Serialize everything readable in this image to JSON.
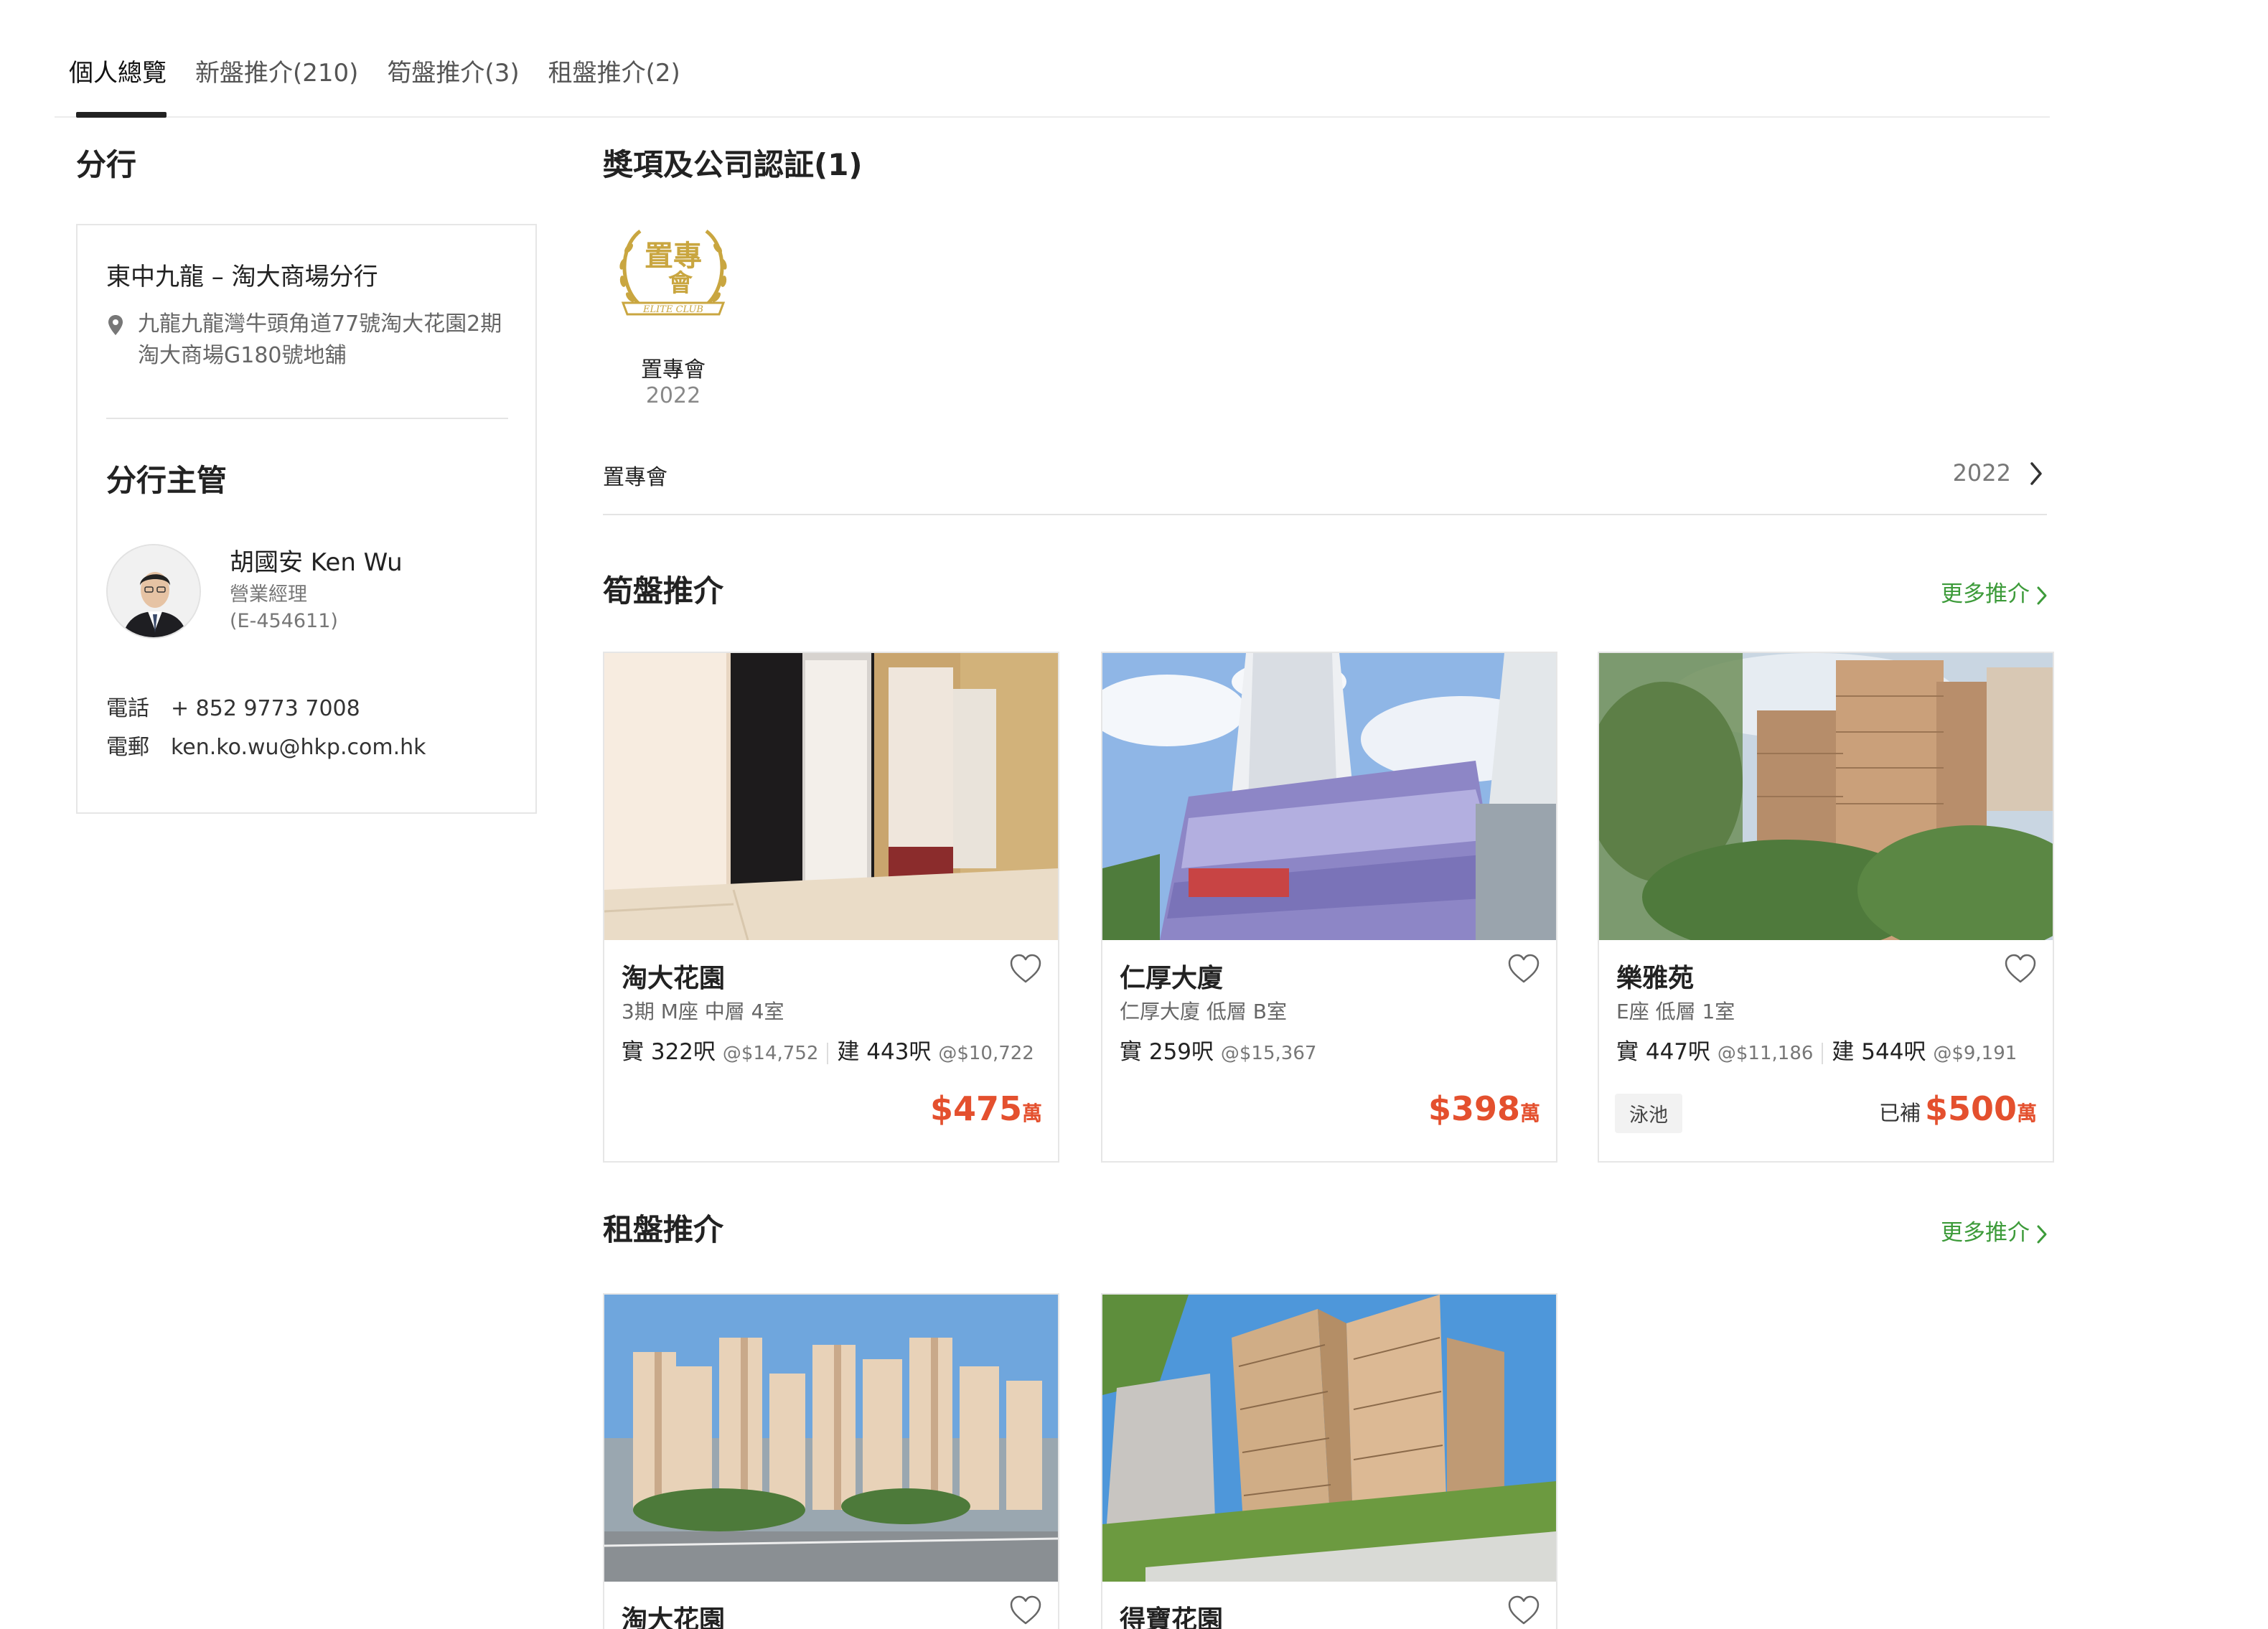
{
  "tabs": [
    {
      "label": "個人總覽"
    },
    {
      "label": "新盤推介(210)"
    },
    {
      "label": "筍盤推介(3)"
    },
    {
      "label": "租盤推介(2)"
    }
  ],
  "branch": {
    "heading": "分行",
    "name": "東中九龍 – 淘大商場分行",
    "address": "九龍九龍灣牛頭角道77號淘大花園2期淘大商場G180號地舖",
    "manager_heading": "分行主管",
    "manager_name": "胡國安 Ken Wu",
    "manager_title": "營業經理",
    "manager_license": "(E-454611)",
    "phone_label": "電話",
    "phone": "+ 852 9773 7008",
    "email_label": "電郵",
    "email": "ken.ko.wu@hkp.com.hk"
  },
  "awards": {
    "heading": "獎項及公司認証(1)",
    "logo_text_top": "置專",
    "logo_text_bottom": "會",
    "logo_banner": "ELITE CLUB",
    "item_name": "置專會",
    "item_year": "2022",
    "row_name": "置專會",
    "row_year": "2022"
  },
  "bargains": {
    "heading": "筍盤推介",
    "more": "更多推介",
    "cards": [
      {
        "title": "淘大花園",
        "sub": "3期 M座 中層 4室",
        "saleable_label": "實",
        "saleable": "322呎",
        "saleable_psf": "@$14,752",
        "gross_label": "建",
        "gross": "443呎",
        "gross_psf": "@$10,722",
        "price": "$475",
        "unit": "萬"
      },
      {
        "title": "仁厚大廈",
        "sub": "仁厚大廈 低層 B室",
        "saleable_label": "實",
        "saleable": "259呎",
        "saleable_psf": "@$15,367",
        "price": "$398",
        "unit": "萬"
      },
      {
        "title": "樂雅苑",
        "sub": "E座 低層 1室",
        "saleable_label": "實",
        "saleable": "447呎",
        "saleable_psf": "@$11,186",
        "gross_label": "建",
        "gross": "544呎",
        "gross_psf": "@$9,191",
        "tag": "泳池",
        "price_prefix": "已補",
        "price": "$500",
        "unit": "萬"
      }
    ]
  },
  "rentals": {
    "heading": "租盤推介",
    "more": "更多推介",
    "cards": [
      {
        "title": "淘大花園"
      },
      {
        "title": "得寶花園"
      }
    ]
  },
  "colors": {
    "accent_green": "#3d9b3a",
    "price_red": "#e4502e",
    "gold": "#c9a640"
  }
}
